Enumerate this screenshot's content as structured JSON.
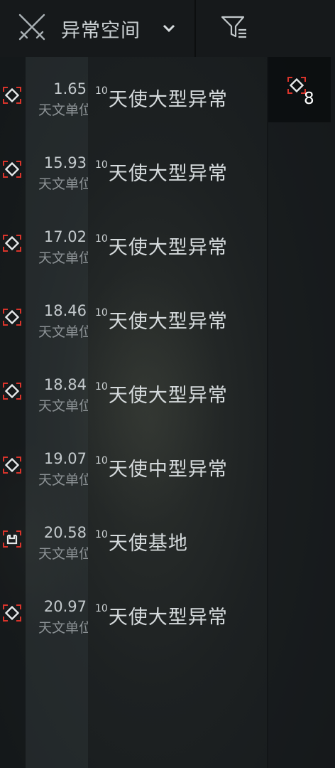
{
  "header": {
    "group_label": "异常空间",
    "group_icon": "crossed-swords-icon",
    "dropdown_icon": "chevron-down-icon",
    "filter_icon": "filter-icon"
  },
  "sites": [
    {
      "distance": "1.65",
      "unit": "天文单位",
      "security": "10",
      "name": "天使大型异常",
      "icon": "combat-anomaly-icon"
    },
    {
      "distance": "15.93",
      "unit": "天文单位",
      "security": "10",
      "name": "天使大型异常",
      "icon": "combat-anomaly-icon"
    },
    {
      "distance": "17.02",
      "unit": "天文单位",
      "security": "10",
      "name": "天使大型异常",
      "icon": "combat-anomaly-icon"
    },
    {
      "distance": "18.46",
      "unit": "天文单位",
      "security": "10",
      "name": "天使大型异常",
      "icon": "combat-anomaly-icon"
    },
    {
      "distance": "18.84",
      "unit": "天文单位",
      "security": "10",
      "name": "天使大型异常",
      "icon": "combat-anomaly-icon"
    },
    {
      "distance": "19.07",
      "unit": "天文单位",
      "security": "10",
      "name": "天使中型异常",
      "icon": "combat-anomaly-icon"
    },
    {
      "distance": "20.58",
      "unit": "天文单位",
      "security": "10",
      "name": "天使基地",
      "icon": "base-site-icon"
    },
    {
      "distance": "20.97",
      "unit": "天文单位",
      "security": "10",
      "name": "天使大型异常",
      "icon": "combat-anomaly-icon"
    }
  ],
  "side_panel": {
    "icon": "combat-anomaly-icon",
    "count": "8"
  },
  "colors": {
    "accent_red": "#d9342b",
    "icon_white": "#e6e9ea",
    "text": "#cfd4d6",
    "topbar": "#16191b"
  }
}
